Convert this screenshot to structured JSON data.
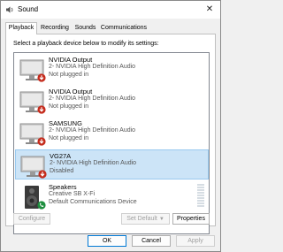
{
  "window": {
    "title": "Sound",
    "close_glyph": "✕"
  },
  "tabs": [
    {
      "label": "Playback",
      "active": true
    },
    {
      "label": "Recording",
      "active": false
    },
    {
      "label": "Sounds",
      "active": false
    },
    {
      "label": "Communications",
      "active": false
    }
  ],
  "instruction": "Select a playback device below to modify its settings:",
  "devices": [
    {
      "name": "NVIDIA Output",
      "line1": "2- NVIDIA High Definition Audio",
      "line2": "Not plugged in",
      "icon": "monitor-icon",
      "status_icon": "down-arrow-badge-icon",
      "selected": false
    },
    {
      "name": "NVIDIA Output",
      "line1": "2- NVIDIA High Definition Audio",
      "line2": "Not plugged in",
      "icon": "monitor-icon",
      "status_icon": "down-arrow-badge-icon",
      "selected": false
    },
    {
      "name": "SAMSUNG",
      "line1": "2- NVIDIA High Definition Audio",
      "line2": "Not plugged in",
      "icon": "monitor-icon",
      "status_icon": "down-arrow-badge-icon",
      "selected": false
    },
    {
      "name": "VG27A",
      "line1": "2- NVIDIA High Definition Audio",
      "line2": "Disabled",
      "icon": "monitor-icon",
      "status_icon": "down-arrow-badge-icon",
      "selected": true
    },
    {
      "name": "Speakers",
      "line1": "Creative SB X-Fi",
      "line2": "Default Communications Device",
      "icon": "speaker-icon",
      "status_icon": "phone-badge-icon",
      "selected": false
    }
  ],
  "buttons": {
    "configure": "Configure",
    "set_default": "Set Default",
    "properties": "Properties",
    "ok": "OK",
    "cancel": "Cancel",
    "apply": "Apply"
  },
  "colors": {
    "selection": "#cce4f7",
    "badge_red": "#c42b1c",
    "badge_green": "#1e8e3e",
    "accent": "#0078d4"
  }
}
